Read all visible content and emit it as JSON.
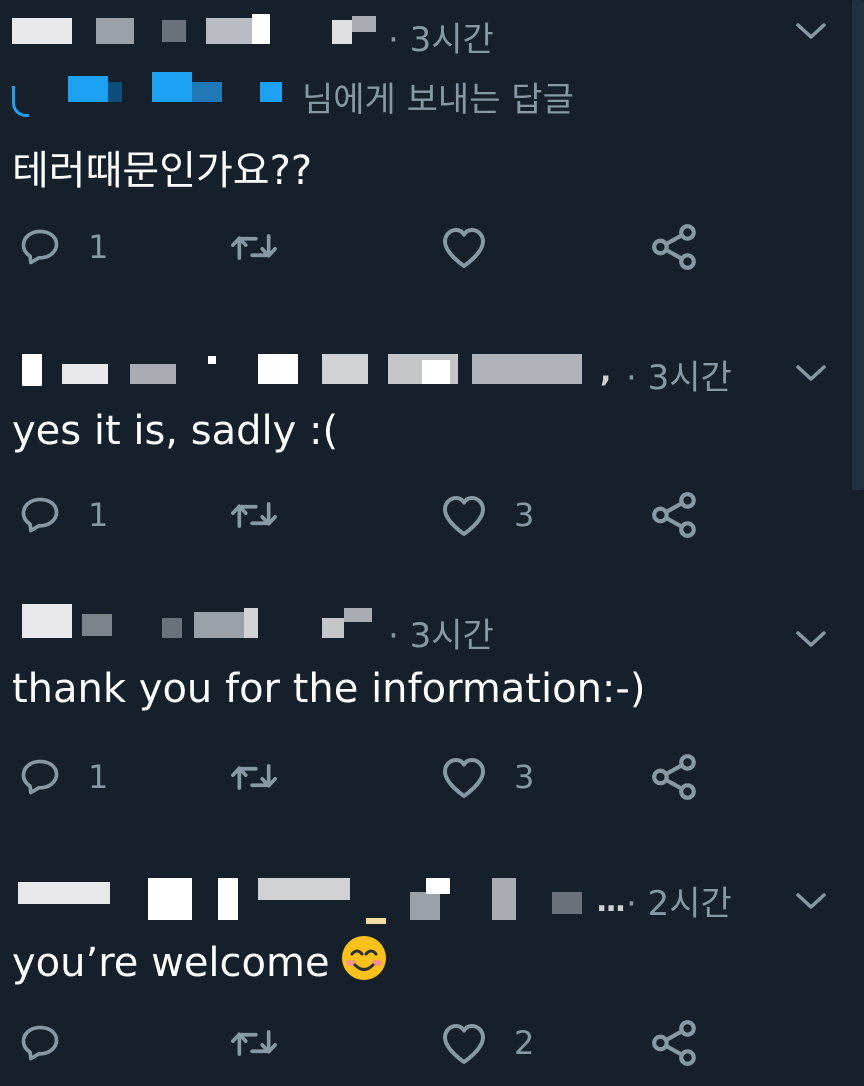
{
  "tweets": [
    {
      "time": "· 3시간",
      "reply_to": "님에게 보내는 답글",
      "text": "테러때문인가요??",
      "replies": "1",
      "retweets": "",
      "likes": ""
    },
    {
      "time": "· 3시간",
      "ellipsis": ",",
      "text": "yes it is, sadly :(",
      "replies": "1",
      "retweets": "",
      "likes": "3"
    },
    {
      "time": "· 3시간",
      "text": "thank you for the information:-)",
      "replies": "1",
      "retweets": "",
      "likes": "3"
    },
    {
      "time": "· 2시간",
      "ellipsis": "...",
      "text": "you’re welcome",
      "emoji": "smiling-face-with-smiling-eyes",
      "replies": "",
      "retweets": "",
      "likes": "2"
    }
  ],
  "colors": {
    "background": "#15202b",
    "muted": "#8899a6",
    "text": "#ffffff",
    "link": "#1da1f2"
  },
  "icons": [
    "reply-icon",
    "retweet-icon",
    "like-icon",
    "share-icon",
    "chevron-down-icon"
  ]
}
